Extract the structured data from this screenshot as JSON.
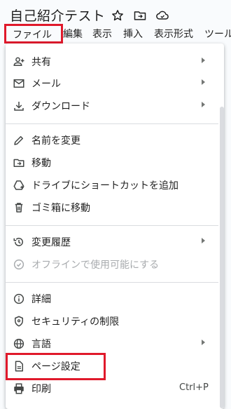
{
  "document": {
    "title": "自己紹介テスト"
  },
  "menubar": {
    "items": [
      "ファイル",
      "編集",
      "表示",
      "挿入",
      "表示形式",
      "ツール"
    ]
  },
  "file_menu": {
    "items": [
      {
        "label": "共有",
        "icon": "person-add-icon",
        "submenu": true
      },
      {
        "label": "メール",
        "icon": "mail-icon",
        "submenu": true
      },
      {
        "label": "ダウンロード",
        "icon": "download-icon",
        "submenu": true
      },
      {
        "label": "名前を変更",
        "icon": "pencil-icon",
        "submenu": false
      },
      {
        "label": "移動",
        "icon": "folder-move-icon",
        "submenu": false
      },
      {
        "label": "ドライブにショートカットを追加",
        "icon": "drive-shortcut-icon",
        "submenu": false
      },
      {
        "label": "ゴミ箱に移動",
        "icon": "trash-icon",
        "submenu": false
      },
      {
        "label": "変更履歴",
        "icon": "history-icon",
        "submenu": true
      },
      {
        "label": "オフラインで使用可能にする",
        "icon": "offline-icon",
        "submenu": false,
        "disabled": true
      },
      {
        "label": "詳細",
        "icon": "info-icon",
        "submenu": false
      },
      {
        "label": "セキュリティの制限",
        "icon": "security-icon",
        "submenu": false
      },
      {
        "label": "言語",
        "icon": "globe-icon",
        "submenu": true
      },
      {
        "label": "ページ設定",
        "icon": "page-icon",
        "submenu": false
      },
      {
        "label": "印刷",
        "icon": "printer-icon",
        "submenu": false,
        "shortcut": "Ctrl+P"
      }
    ]
  },
  "colors": {
    "highlight": "#e0192b",
    "icon": "#444746",
    "disabled": "#a8abae"
  }
}
